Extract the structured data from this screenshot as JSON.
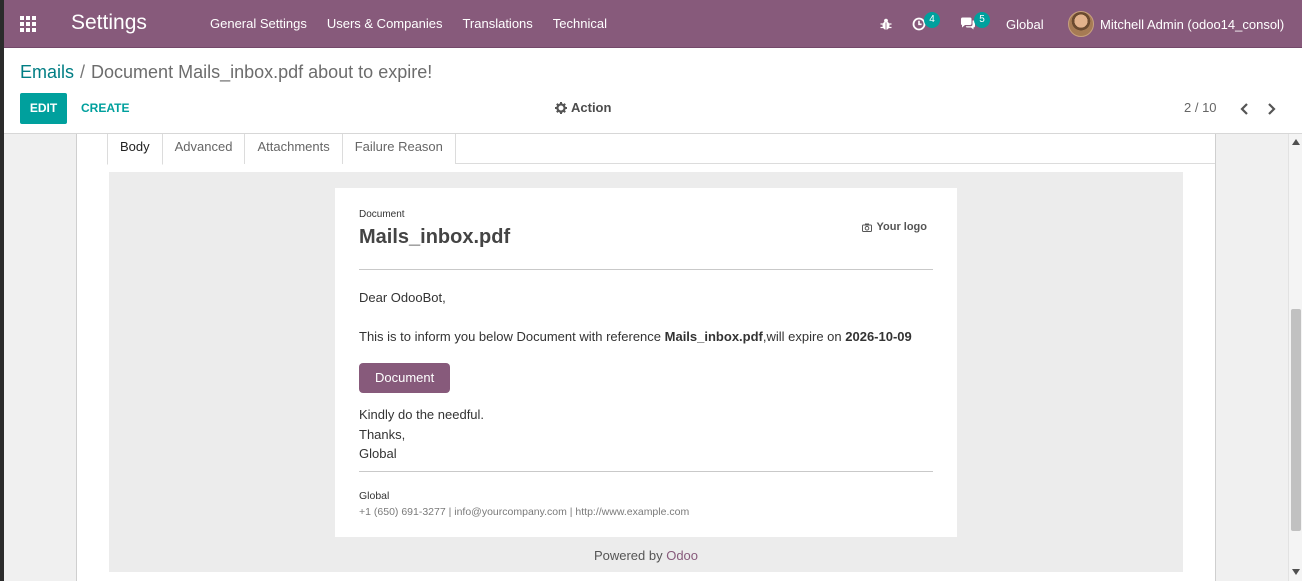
{
  "navbar": {
    "app_title": "Settings",
    "menu": [
      "General Settings",
      "Users & Companies",
      "Translations",
      "Technical"
    ],
    "activity_count": "4",
    "message_count": "5",
    "company": "Global",
    "user": "Mitchell Admin (odoo14_consol)",
    "background_color": "#875a7b"
  },
  "control": {
    "breadcrumb_parent": "Emails",
    "breadcrumb_separator": "/",
    "breadcrumb_current": "Document Mails_inbox.pdf about to expire!",
    "edit_label": "EDIT",
    "create_label": "CREATE",
    "action_label": "Action",
    "pager": "2 / 10"
  },
  "tabs": [
    "Body",
    "Advanced",
    "Attachments",
    "Failure Reason"
  ],
  "email": {
    "label": "Document",
    "title": "Mails_inbox.pdf",
    "logo_text": "Your logo",
    "greeting": "Dear OdooBot,",
    "body_prefix": "This is to inform you below Document with reference ",
    "reference": "Mails_inbox.pdf",
    "body_middle": ",will expire on ",
    "expiry_date": "2026-10-09",
    "button_label": "Document",
    "closing_line1": "Kindly do the needful.",
    "closing_line2": "Thanks,",
    "closing_line3": "Global",
    "company_name": "Global",
    "company_info": "+1 (650) 691-3277 | info@yourcompany.com | http://www.example.com",
    "powered_prefix": "Powered by ",
    "powered_brand": "Odoo"
  }
}
